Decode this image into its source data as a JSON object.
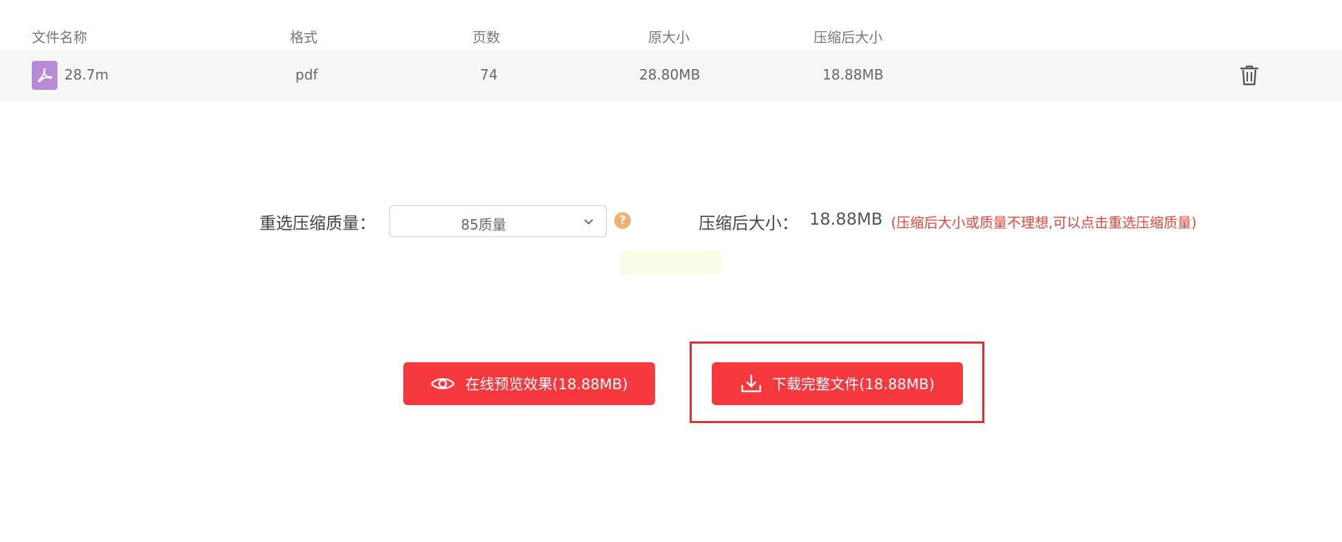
{
  "table": {
    "headers": {
      "name": "文件名称",
      "format": "格式",
      "pages": "页数",
      "original_size": "原大小",
      "compressed_size": "压缩后大小"
    },
    "rows": [
      {
        "icon": "pdf-file-icon",
        "name": "28.7m",
        "format": "pdf",
        "pages": "74",
        "original_size": "28.80MB",
        "compressed_size": "18.88MB",
        "action_icon": "trash-icon"
      }
    ]
  },
  "quality": {
    "label": "重选压缩质量：",
    "selected": "85质量",
    "help_icon": "question-icon",
    "help_glyph": "?"
  },
  "result": {
    "label": "压缩后大小：",
    "value": "18.88MB",
    "hint": "(压缩后大小或质量不理想,可以点击重选压缩质量)"
  },
  "buttons": {
    "preview_label": "在线预览效果(18.88MB)",
    "preview_icon": "eye-icon",
    "download_label": "下载完整文件(18.88MB)",
    "download_icon": "download-icon"
  },
  "colors": {
    "accent": "#f5393f",
    "hint": "#e8453c",
    "pdf_icon": "#b78ad8",
    "highlight_border": "#e22a2f"
  }
}
